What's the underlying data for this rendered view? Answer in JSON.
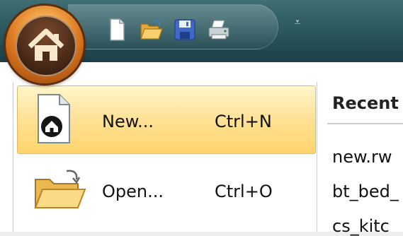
{
  "menu": {
    "items": [
      {
        "label": "New...",
        "shortcut": "Ctrl+N",
        "icon": "new-document-house-icon"
      },
      {
        "label": "Open...",
        "shortcut": "Ctrl+O",
        "icon": "open-folder-icon"
      }
    ]
  },
  "recent": {
    "title": "Recent",
    "files": [
      "new.rw",
      "bt_bed_",
      "cs_kitc"
    ]
  },
  "quick_access": {
    "buttons": [
      "new-icon",
      "open-icon",
      "save-icon",
      "print-icon"
    ],
    "dropdown_glyph": "⩡"
  },
  "colors": {
    "titlebar": "#2d5961",
    "hover_highlight": "#ffd46c",
    "office_button": "#d8731e"
  }
}
